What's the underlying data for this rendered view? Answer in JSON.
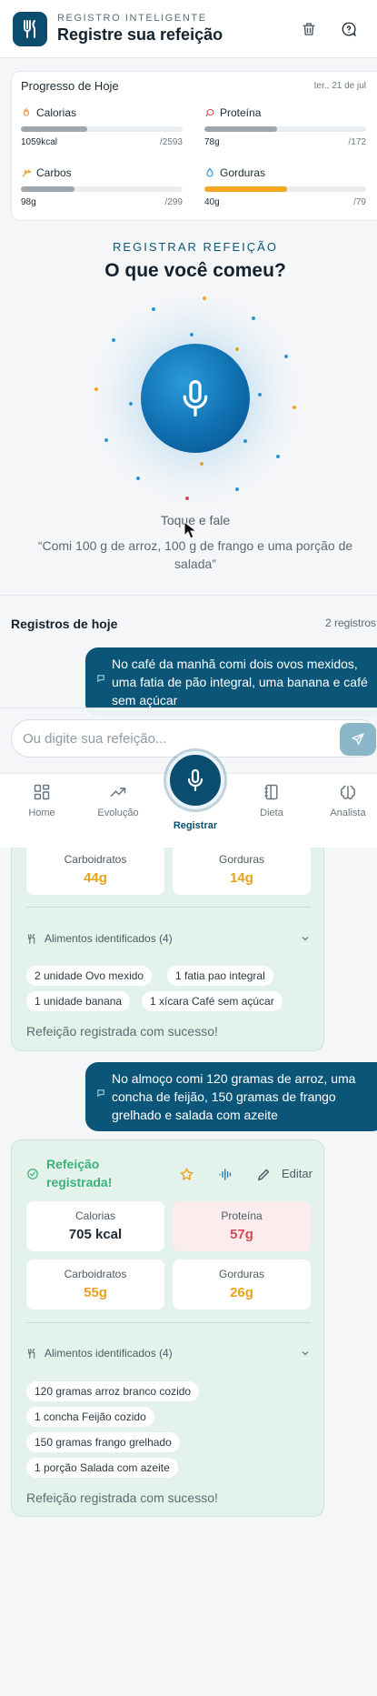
{
  "header": {
    "kicker": "REGISTRO INTELIGENTE",
    "title": "Registre sua refeição",
    "logo_icon": "fork-knife-logo-icon",
    "actions": [
      "trash-icon",
      "help-icon"
    ]
  },
  "progress": {
    "title": "Progresso de Hoje",
    "date": "ter., 21 de jul",
    "macros": [
      {
        "label": "Calorias",
        "value": "1059kcal",
        "goal": "/2593",
        "fraction": 0.41,
        "color": "#9ea7ae",
        "icon": "flame-icon"
      },
      {
        "label": "Proteína",
        "value": "78g",
        "goal": "/172",
        "fraction": 0.45,
        "color": "#9ea7ae",
        "icon": "meat-icon"
      },
      {
        "label": "Carbos",
        "value": "98g",
        "goal": "/299",
        "fraction": 0.33,
        "color": "#9ea7ae",
        "icon": "wheat-icon"
      },
      {
        "label": "Gorduras",
        "value": "40g",
        "goal": "/79",
        "fraction": 0.51,
        "color": "#f5a623",
        "icon": "drop-icon"
      }
    ]
  },
  "voice": {
    "kicker": "REGISTRAR REFEIÇÃO",
    "question": "O que você comeu?",
    "tap_label": "Toque e fale",
    "example": "“Comi 100 g de arroz, 100 g de frango e uma porção de salada”"
  },
  "log": {
    "title": "Registros de hoje",
    "count": "2 registros"
  },
  "messages": [
    {
      "text": "No café da manhã comi dois ovos mexidos, uma fatia de pão integral, uma banana e café sem açúcar"
    },
    {
      "text": "No almoço comi 120 gramas de arroz, uma concha de feijão, 150 gramas de frango grelhado e salada com azeite"
    }
  ],
  "meal1": {
    "stats": [
      {
        "label": "Carboidratos",
        "value": "44g"
      },
      {
        "label": "Gorduras",
        "value": "14g"
      }
    ],
    "identified": "Alimentos identificados (4)",
    "chips": [
      "2 unidade Ovo mexido",
      "1 fatia pao integral",
      "1 unidade banana",
      "1 xícara Café sem açúcar"
    ],
    "success": "Refeição registrada com sucesso!"
  },
  "meal2": {
    "status": "Refeição registrada!",
    "edit_label": "Editar",
    "stats": [
      {
        "label": "Calorias",
        "value": "705 kcal"
      },
      {
        "label": "Proteína",
        "value": "57g"
      },
      {
        "label": "Carboidratos",
        "value": "55g"
      },
      {
        "label": "Gorduras",
        "value": "26g"
      }
    ],
    "identified": "Alimentos identificados (4)",
    "chips": [
      "120 gramas arroz branco cozido",
      "1 concha Feijão cozido",
      "150 gramas frango grelhado",
      "1 porção Salada com azeite"
    ],
    "success": "Refeição registrada com sucesso!"
  },
  "input": {
    "placeholder": "Ou digite sua refeição..."
  },
  "nav": {
    "items": [
      {
        "label": "Home",
        "icon": "home-grid-icon"
      },
      {
        "label": "Evolução",
        "icon": "trend-icon"
      },
      {
        "label": "Registrar",
        "icon": "mic-icon"
      },
      {
        "label": "Dieta",
        "icon": "notebook-icon"
      },
      {
        "label": "Analista",
        "icon": "brain-icon"
      }
    ]
  },
  "colors": {
    "primary": "#0b4d6e",
    "success": "#3bb27a",
    "carbs": "#e8a21a",
    "protein": "#d64a5b"
  }
}
